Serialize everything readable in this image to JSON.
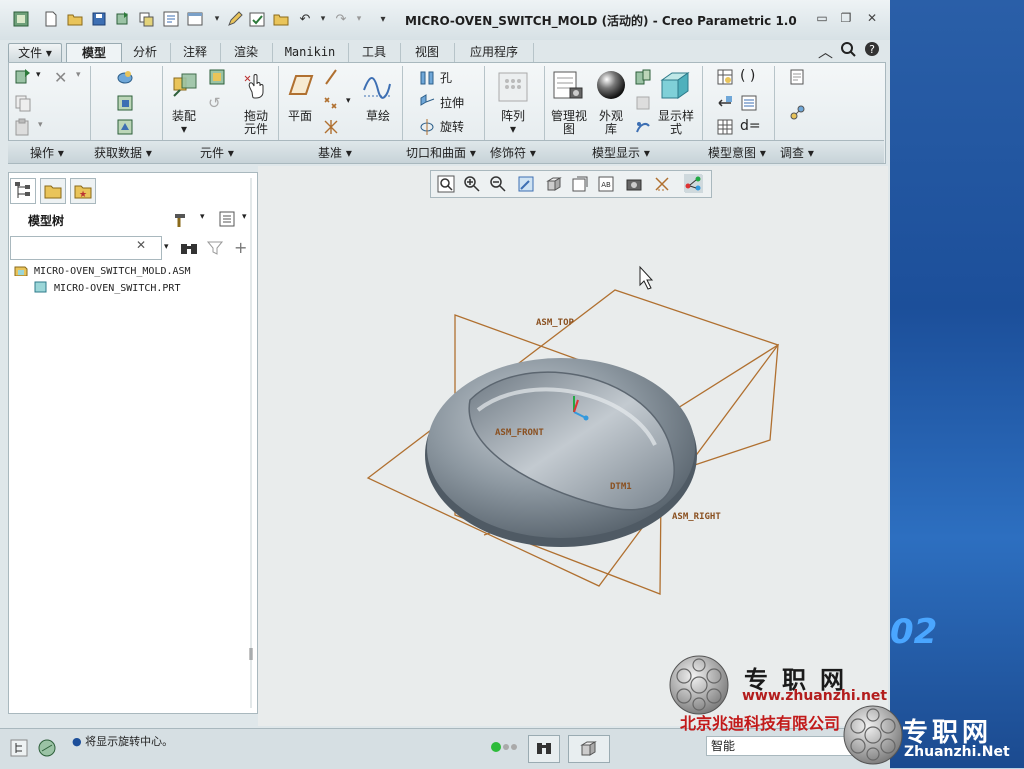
{
  "window": {
    "title": "MICRO-OVEN_SWITCH_MOLD (活动的) - Creo Parametric 1.0"
  },
  "tabs": [
    {
      "label": "文件"
    },
    {
      "label": "模型"
    },
    {
      "label": "分析"
    },
    {
      "label": "注释"
    },
    {
      "label": "渲染"
    },
    {
      "label": "Manikin"
    },
    {
      "label": "工具"
    },
    {
      "label": "视图"
    },
    {
      "label": "应用程序"
    }
  ],
  "ribbon": {
    "assemble": "装配",
    "drag": "拖动\n元件",
    "plane": "平面",
    "sketch": "草绘",
    "hole": "孔",
    "extrude": "拉伸",
    "revolve": "旋转",
    "pattern": "阵列",
    "manage_views": "管理视\n图",
    "appearance": "外观\n库",
    "display_style": "显示样\n式",
    "dequals": "d="
  },
  "groups": [
    {
      "label": "操作"
    },
    {
      "label": "获取数据"
    },
    {
      "label": "元件"
    },
    {
      "label": "基准"
    },
    {
      "label": "切口和曲面"
    },
    {
      "label": "修饰符"
    },
    {
      "label": "模型显示"
    },
    {
      "label": "模型意图"
    },
    {
      "label": "调查"
    }
  ],
  "model_tree": {
    "title": "模型树",
    "search_placeholder": "",
    "nodes": [
      {
        "label": "MICRO-OVEN_SWITCH_MOLD.ASM"
      },
      {
        "label": "MICRO-OVEN_SWITCH.PRT"
      }
    ]
  },
  "datum_labels": {
    "top": "ASM_TOP",
    "front": "ASM_FRONT",
    "right": "ASM_RIGHT",
    "dtm": "DTM1"
  },
  "status": {
    "message": "将显示旋转中心。",
    "filter": "智能"
  },
  "watermark": {
    "zh": "专职网",
    "url": "www.zhuanzhi.net",
    "company": "北京兆迪科技有限公司",
    "zh2": "专职网",
    "url2": "Zhuanzhi.Net"
  },
  "desktop": {
    "text": "02"
  },
  "colors": {
    "datum": "#b07030",
    "model": "#7f8b95",
    "accent": "#2a5fa8"
  }
}
